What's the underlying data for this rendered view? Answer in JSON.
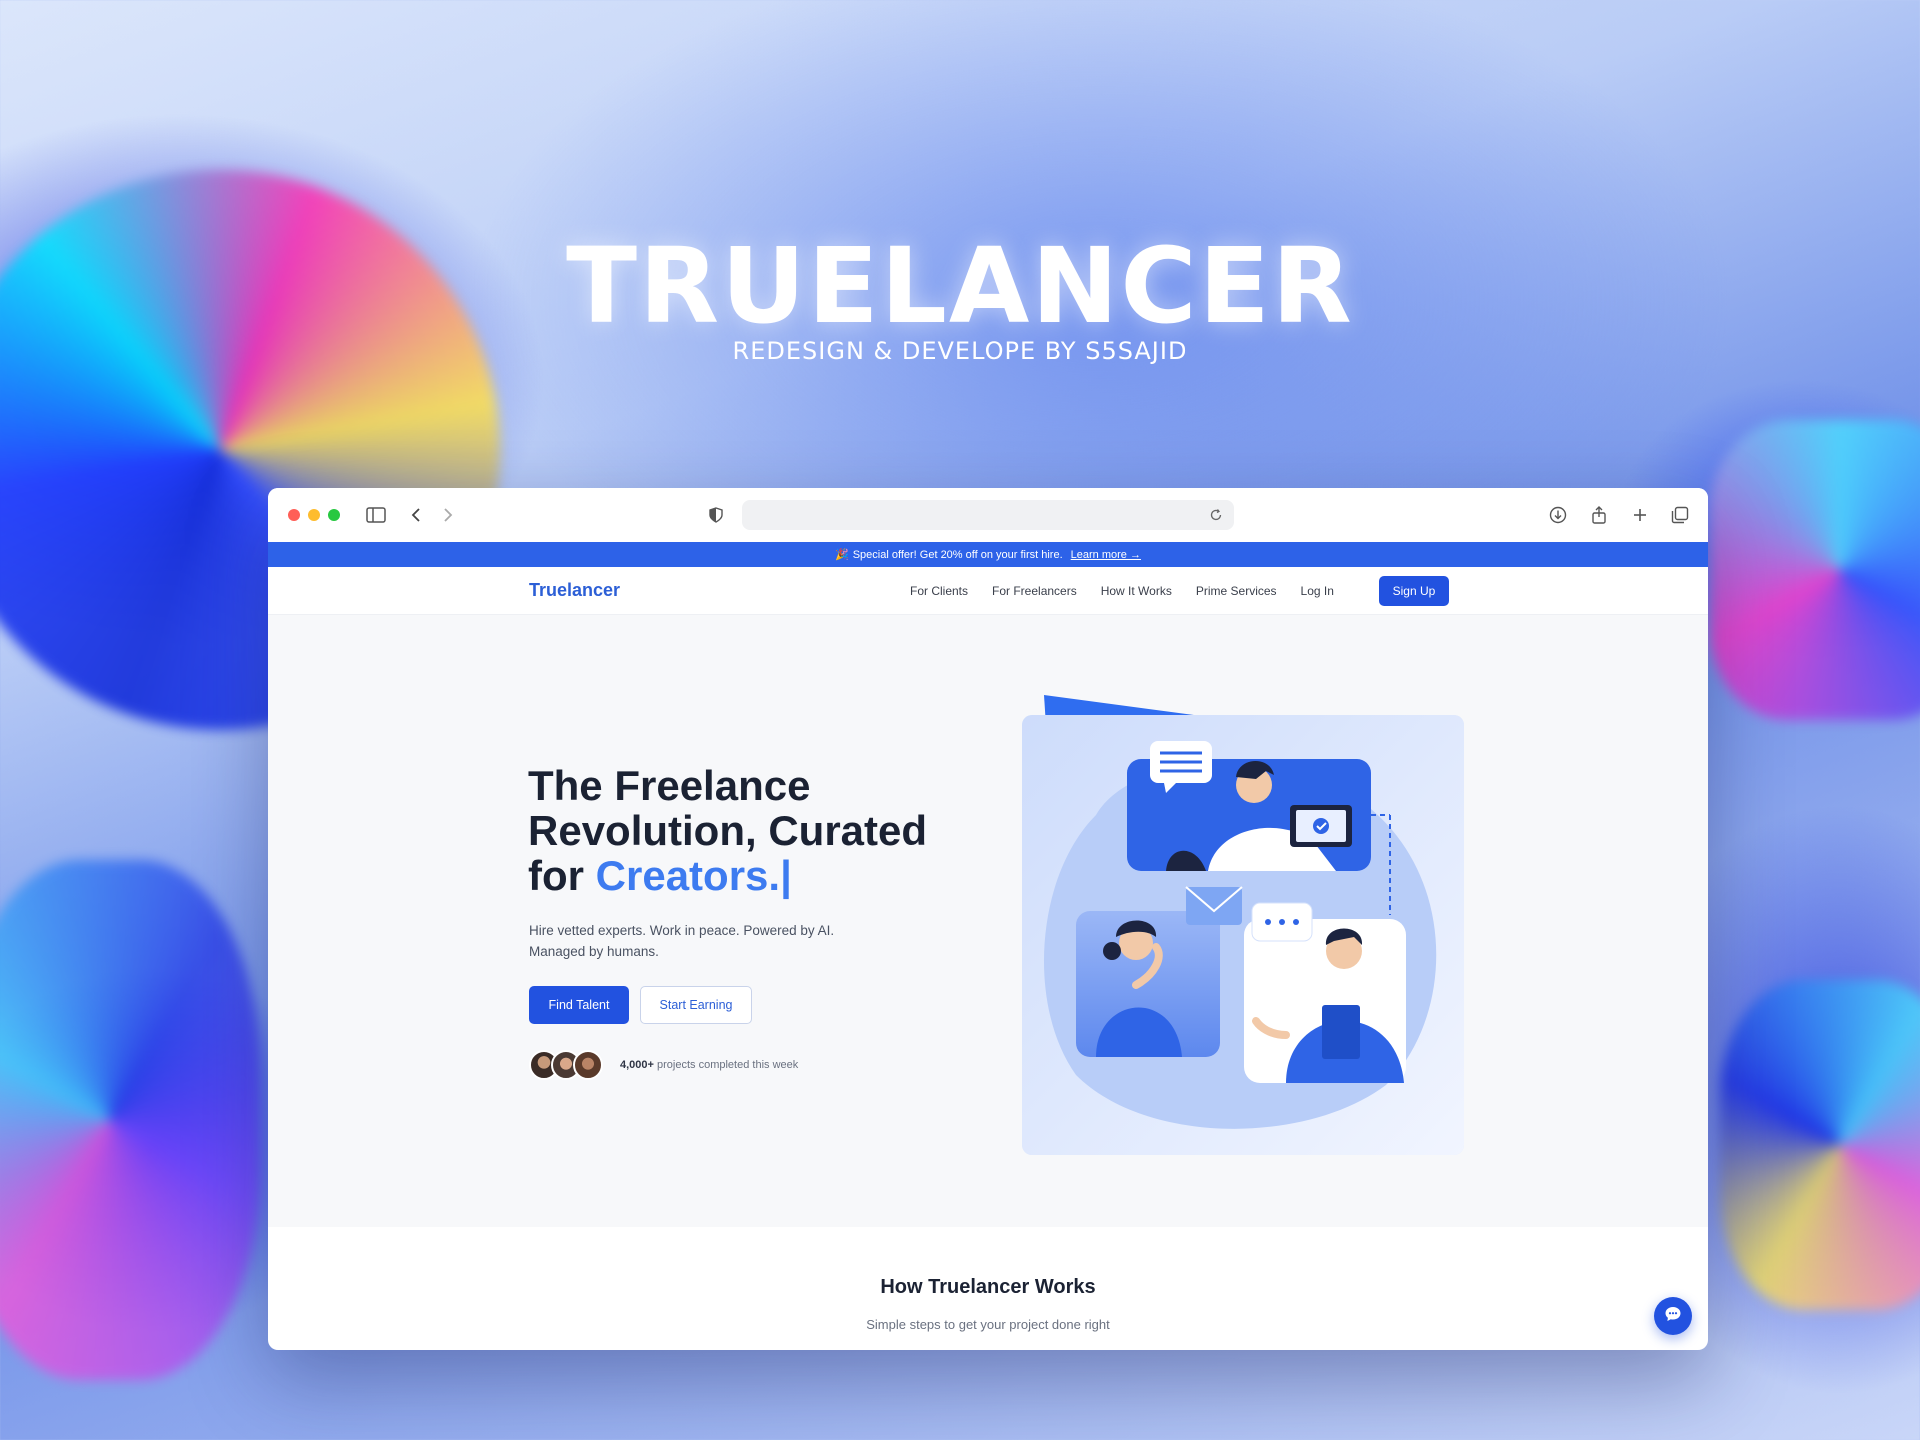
{
  "showcase": {
    "title": "TRUELANCER",
    "subtitle": "REDESIGN & DEVELOPE BY S5SAJID"
  },
  "browser": {
    "url": ""
  },
  "promo": {
    "emoji": "🎉",
    "text": "Special offer! Get 20% off on your first hire.",
    "link": "Learn more →"
  },
  "nav": {
    "logo": "Truelancer",
    "links": [
      "For Clients",
      "For Freelancers",
      "How It Works",
      "Prime Services",
      "Log In"
    ],
    "signup": "Sign Up"
  },
  "hero": {
    "headline_line1": "The Freelance",
    "headline_line2": "Revolution, Curated",
    "headline_line3_prefix": "for ",
    "headline_accent": "Creators.|",
    "description_line1": "Hire vetted experts. Work in peace. Powered by AI.",
    "description_line2": "Managed by humans.",
    "primary_cta": "Find Talent",
    "secondary_cta": "Start Earning",
    "proof_count": "4,000+",
    "proof_text": " projects completed this week"
  },
  "how_it_works": {
    "title": "How Truelancer Works",
    "subtitle": "Simple steps to get your project done right"
  },
  "colors": {
    "primary": "#2252e0",
    "accent": "#3d7bf0",
    "promo_bg": "#2d62e8",
    "heading": "#1b2233"
  },
  "icons": [
    "sidebar-icon",
    "back-icon",
    "forward-icon",
    "shield-icon",
    "reload-icon",
    "download-icon",
    "share-icon",
    "new-tab-icon",
    "tabs-icon",
    "chat-icon"
  ]
}
